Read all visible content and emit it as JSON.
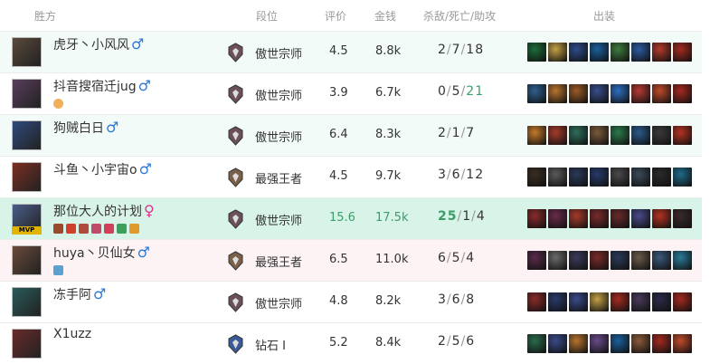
{
  "header": {
    "team_label": "胜方",
    "rank_label": "段位",
    "score_label": "评价",
    "gold_label": "金钱",
    "kda_label": "杀敌/死亡/助攻",
    "items_label": "出装"
  },
  "rows": [
    {
      "name": "虎牙丶小风风",
      "gender": "♂",
      "rank": "傲世宗师",
      "score": "4.5",
      "gold": "8.8k",
      "k": "2",
      "d": "7",
      "a": "18",
      "avatar_color": "#5b4a3a",
      "rank_color": "#6b4f5a",
      "items": [
        "#1d6b3a",
        "#c4a146",
        "#2e4c8a",
        "#1a5f9c",
        "#3d7c3f",
        "#2c5aa1",
        "#b23a2a",
        "#a32a20"
      ]
    },
    {
      "name": "抖音搜宿迁jug",
      "gender": "♂",
      "rank": "傲世宗师",
      "score": "3.9",
      "gold": "6.7k",
      "k": "0",
      "d": "5",
      "a": "21",
      "a_green": true,
      "avatar_color": "#5a3d5e",
      "rank_color": "#6b4f5a",
      "items": [
        "#2f5f8f",
        "#b8742e",
        "#9a5a26",
        "#364e8a",
        "#2d6ec2",
        "#b43a33",
        "#c04a2a",
        "#a3291f"
      ]
    },
    {
      "name": "狗贼白日",
      "gender": "♂",
      "rank": "傲世宗师",
      "score": "6.4",
      "gold": "8.3k",
      "k": "2",
      "d": "1",
      "a": "7",
      "avatar_color": "#2f4a7d",
      "rank_color": "#6b4f5a",
      "items": [
        "#c47a2a",
        "#a53c2a",
        "#2d6e5a",
        "#7a5a3a",
        "#2a7a4a",
        "#2a5a8a",
        "#3a3a3a",
        "#b43222"
      ]
    },
    {
      "name": "斗鱼丶小宇宙o",
      "gender": "♂",
      "rank": "最强王者",
      "score": "4.5",
      "gold": "9.7k",
      "k": "3",
      "d": "6",
      "a": "12",
      "avatar_color": "#7b2e22",
      "rank_color": "#7a6048",
      "items": [
        "#3a2e22",
        "#5a5a5a",
        "#2a3a5a",
        "#263a6a",
        "#4a4a4a",
        "#3a4a5a",
        "#2a2a2a",
        "#1f6a8a"
      ]
    },
    {
      "name": "那位大人的计划",
      "gender": "♀",
      "rank": "傲世宗师",
      "score": "15.6",
      "gold": "17.5k",
      "k": "25",
      "d": "1",
      "a": "4",
      "mvp": true,
      "avatar_color": "#4a5e8a",
      "rank_color": "#6b4f5a",
      "mvp_label": "MVP",
      "items": [
        "#8a2a2a",
        "#6a2a4a",
        "#a83a2a",
        "#7a2a2a",
        "#6a2a2a",
        "#4a4a8a",
        "#b43222",
        "#3a2a2a"
      ]
    },
    {
      "name": "huya丶贝仙女",
      "gender": "♂",
      "rank": "最强王者",
      "score": "6.5",
      "gold": "11.0k",
      "k": "6",
      "d": "5",
      "a": "4",
      "avatar_color": "#6a4a3a",
      "rank_color": "#7a6048",
      "items": [
        "#5a2a4a",
        "#6a6a6a",
        "#3a3a5a",
        "#7a2a2a",
        "#2a3a5a",
        "#6a5a4a",
        "#3a5a7a",
        "#2a7a9a"
      ]
    },
    {
      "name": "冻手阿",
      "gender": "♂",
      "rank": "傲世宗师",
      "score": "4.8",
      "gold": "8.2k",
      "k": "3",
      "d": "6",
      "a": "8",
      "avatar_color": "#2a5a5a",
      "rank_color": "#6b4f5a",
      "items": [
        "#8a2a2a",
        "#2a3a6a",
        "#3a4a8a",
        "#c4a146",
        "#a32a20",
        "#4a3a5a",
        "#2a2a4a",
        "#a3291f"
      ]
    },
    {
      "name": "X1uzz",
      "gender": "",
      "rank": "钻石 I",
      "score": "5.2",
      "gold": "8.4k",
      "k": "2",
      "d": "5",
      "a": "6",
      "avatar_color": "#6a2a2a",
      "rank_color": "#3a5a9a",
      "items": [
        "#2a6a4a",
        "#3a4a8a",
        "#b8742e",
        "#6a4a8a",
        "#1a5f9c",
        "#8a5a3a",
        "#a3291f",
        "#c04a2a"
      ]
    }
  ]
}
